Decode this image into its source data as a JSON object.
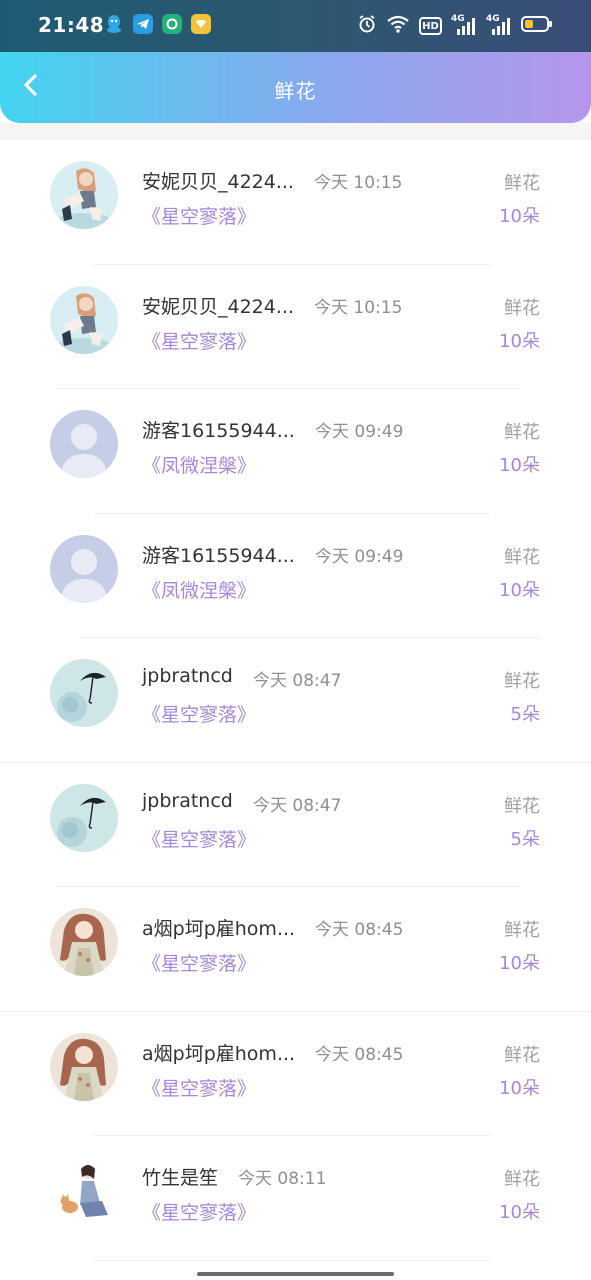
{
  "status_bar": {
    "time": "21:48",
    "apps": [
      "qq-icon",
      "telegram-icon",
      "green-app-icon",
      "wallet-app-icon"
    ],
    "indicators": [
      "alarm-icon",
      "wifi-icon",
      "hd-icon",
      "signal-4g-icon",
      "signal-4g-icon",
      "battery-icon"
    ],
    "hd_label": "HD",
    "network_label": "4G",
    "battery_level": 0.4
  },
  "header": {
    "title": "鲜花",
    "back_icon": "chevron-left-icon"
  },
  "records": [
    {
      "name": "安妮贝贝_4224...",
      "time": "今天 10:15",
      "book": "《星空寥落》",
      "type": "鲜花",
      "count": "10朵",
      "avatar": "girl-sitting-avatar"
    },
    {
      "name": "安妮贝贝_4224...",
      "time": "今天 10:15",
      "book": "《星空寥落》",
      "type": "鲜花",
      "count": "10朵",
      "avatar": "girl-sitting-avatar"
    },
    {
      "name": "游客16155944...",
      "time": "今天 09:49",
      "book": "《凤微涅槃》",
      "type": "鲜花",
      "count": "10朵",
      "avatar": "default-user-avatar"
    },
    {
      "name": "游客16155944...",
      "time": "今天 09:49",
      "book": "《凤微涅槃》",
      "type": "鲜花",
      "count": "10朵",
      "avatar": "default-user-avatar"
    },
    {
      "name": "jpbratncd",
      "time": "今天 08:47",
      "book": "《星空寥落》",
      "type": "鲜花",
      "count": "5朵",
      "avatar": "umbrella-rose-avatar"
    },
    {
      "name": "jpbratncd",
      "time": "今天 08:47",
      "book": "《星空寥落》",
      "type": "鲜花",
      "count": "5朵",
      "avatar": "umbrella-rose-avatar"
    },
    {
      "name": "a烟p坷p雇hom...",
      "time": "今天 08:45",
      "book": "《星空寥落》",
      "type": "鲜花",
      "count": "10朵",
      "avatar": "anime-girl-avatar"
    },
    {
      "name": "a烟p坷p雇hom...",
      "time": "今天 08:45",
      "book": "《星空寥落》",
      "type": "鲜花",
      "count": "10朵",
      "avatar": "anime-girl-avatar"
    },
    {
      "name": "竹生是笙",
      "time": "今天 08:11",
      "book": "《星空寥落》",
      "type": "鲜花",
      "count": "10朵",
      "avatar": "girl-with-cat-avatar"
    }
  ],
  "colors": {
    "accent": "#a687d8",
    "header_gradient_start": "#43d4f1",
    "header_gradient_end": "#b596ec"
  }
}
